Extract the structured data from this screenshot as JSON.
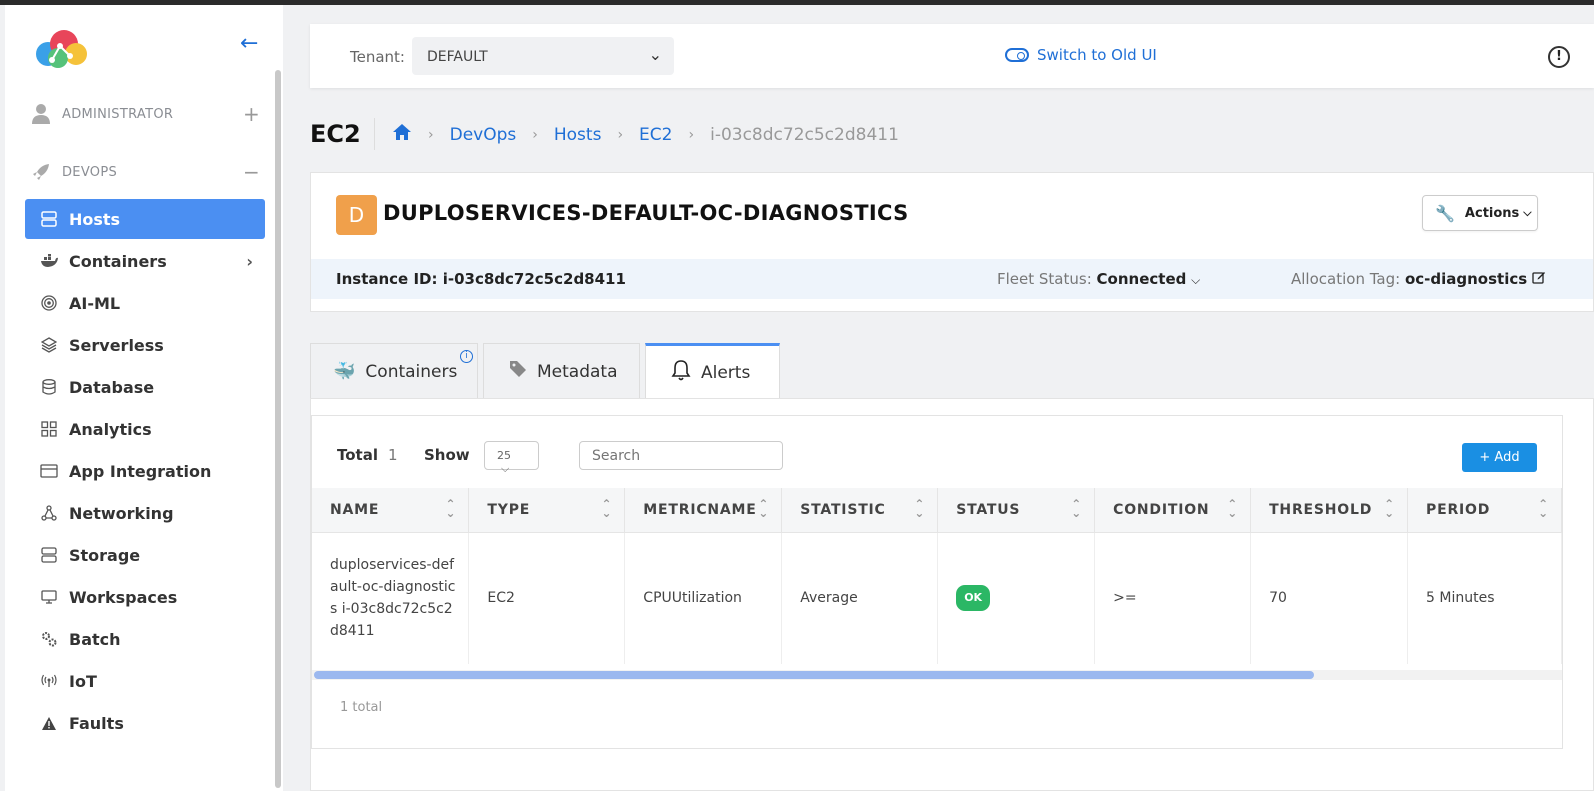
{
  "sidebar": {
    "sections": [
      {
        "label": "ADMINISTRATOR",
        "toggle": "+"
      },
      {
        "label": "DEVOPS",
        "toggle": "−"
      }
    ],
    "items": [
      {
        "label": "Hosts",
        "icon": "server-icon"
      },
      {
        "label": "Containers",
        "icon": "docker-icon"
      },
      {
        "label": "AI-ML",
        "icon": "target-icon"
      },
      {
        "label": "Serverless",
        "icon": "layers-icon"
      },
      {
        "label": "Database",
        "icon": "database-icon"
      },
      {
        "label": "Analytics",
        "icon": "grid-icon"
      },
      {
        "label": "App Integration",
        "icon": "window-icon"
      },
      {
        "label": "Networking",
        "icon": "network-icon"
      },
      {
        "label": "Storage",
        "icon": "storage-icon"
      },
      {
        "label": "Workspaces",
        "icon": "monitor-icon"
      },
      {
        "label": "Batch",
        "icon": "gears-icon"
      },
      {
        "label": "IoT",
        "icon": "antenna-icon"
      },
      {
        "label": "Faults",
        "icon": "warning-icon"
      }
    ],
    "collapse_icon": "←"
  },
  "header": {
    "tenant_label": "Tenant:",
    "tenant_value": "DEFAULT",
    "switch_label": "Switch to Old UI"
  },
  "page": {
    "title": "EC2",
    "breadcrumb": [
      "DevOps",
      "Hosts",
      "EC2",
      "i-03c8dc72c5c2d8411"
    ]
  },
  "host": {
    "avatar": "D",
    "name": "DUPLOSERVICES-DEFAULT-OC-DIAGNOSTICS",
    "actions_label": "Actions",
    "instance_id_label": "Instance ID:",
    "instance_id": "i-03c8dc72c5c2d8411",
    "fleet_label": "Fleet Status:",
    "fleet_value": "Connected",
    "alloc_label": "Allocation Tag:",
    "alloc_value": "oc-diagnostics"
  },
  "tabs": [
    {
      "label": "Containers"
    },
    {
      "label": "Metadata"
    },
    {
      "label": "Alerts"
    }
  ],
  "alerts": {
    "total_label": "Total",
    "total_value": "1",
    "show_label": "Show",
    "show_value": "25",
    "search_placeholder": "Search",
    "add_label": "+ Add",
    "columns": [
      "NAME",
      "TYPE",
      "METRICNAME",
      "STATISTIC",
      "STATUS",
      "CONDITION",
      "THRESHOLD",
      "PERIOD"
    ],
    "rows": [
      {
        "name": "duploservices-default-oc-diagnostics i-03c8dc72c5c2d8411",
        "type": "EC2",
        "metricname": "CPUUtilization",
        "statistic": "Average",
        "status": "OK",
        "condition": ">=",
        "threshold": "70",
        "period": "5 Minutes"
      }
    ],
    "footer": "1 total",
    "scroll_fraction": 0.8
  },
  "colors": {
    "accent": "#4b8ff2",
    "link": "#1f6fd6",
    "ok": "#2bb765",
    "avatar": "#f0a04b",
    "add": "#1a8fe3"
  }
}
